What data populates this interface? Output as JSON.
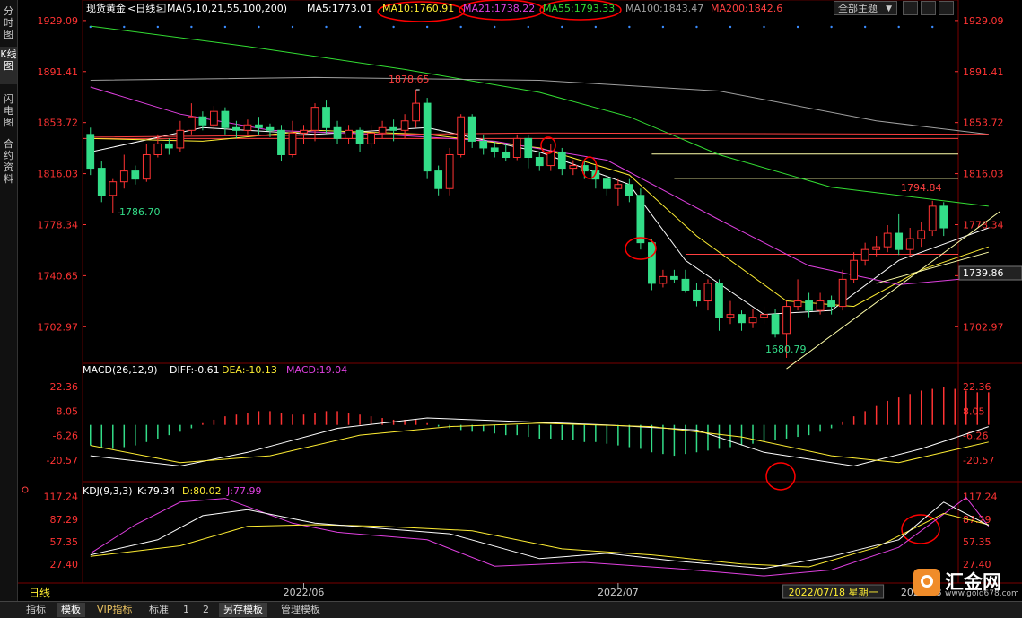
{
  "left_tabs": [
    {
      "label": "分时图",
      "active": false
    },
    {
      "label": "K线图",
      "active": true
    },
    {
      "label": "闪电图",
      "active": false
    },
    {
      "label": "合约资料",
      "active": false
    }
  ],
  "header": {
    "instrument": "现货黄金",
    "period": "<日线>",
    "ma_label": "MA(5,10,21,55,100,200)",
    "ma": [
      {
        "name": "MA5",
        "text": "MA5:1773.01",
        "color": "#ffffff"
      },
      {
        "name": "MA10",
        "text": "MA10:1760.91",
        "color": "#ffee33"
      },
      {
        "name": "MA21",
        "text": "MA21:1738.22",
        "color": "#e040e0"
      },
      {
        "name": "MA55",
        "text": "MA55:1793.33",
        "color": "#33dd33"
      },
      {
        "name": "MA100",
        "text": "MA100:1843.47",
        "color": "#a0a0a0"
      },
      {
        "name": "MA200",
        "text": "MA200:1842.6",
        "color": "#ff4040"
      }
    ],
    "theme_select": "全部主题"
  },
  "price_axis": {
    "ticks": [
      1929.09,
      1891.41,
      1853.72,
      1816.03,
      1778.34,
      1740.65,
      1702.97
    ],
    "current_price": "1739.86",
    "y_range": [
      1680.79,
      1929.09
    ]
  },
  "annotations": {
    "high_1": "1878.65",
    "low_1": "1786.70",
    "low_2": "1680.79",
    "high_2": "1794.84"
  },
  "candles": [
    [
      1845,
      1820,
      1850,
      1815
    ],
    [
      1820,
      1800,
      1825,
      1795
    ],
    [
      1800,
      1810,
      1812,
      1787
    ],
    [
      1810,
      1818,
      1830,
      1805
    ],
    [
      1818,
      1812,
      1822,
      1808
    ],
    [
      1812,
      1830,
      1838,
      1810
    ],
    [
      1830,
      1838,
      1845,
      1828
    ],
    [
      1838,
      1835,
      1842,
      1830
    ],
    [
      1835,
      1848,
      1855,
      1832
    ],
    [
      1848,
      1858,
      1868,
      1845
    ],
    [
      1858,
      1852,
      1862,
      1848
    ],
    [
      1852,
      1862,
      1866,
      1848
    ],
    [
      1862,
      1850,
      1865,
      1845
    ],
    [
      1850,
      1848,
      1855,
      1842
    ],
    [
      1848,
      1852,
      1856,
      1845
    ],
    [
      1852,
      1850,
      1858,
      1845
    ],
    [
      1850,
      1848,
      1853,
      1843
    ],
    [
      1848,
      1830,
      1852,
      1825
    ],
    [
      1830,
      1846,
      1855,
      1828
    ],
    [
      1846,
      1848,
      1852,
      1838
    ],
    [
      1848,
      1865,
      1868,
      1840
    ],
    [
      1865,
      1850,
      1870,
      1846
    ],
    [
      1850,
      1842,
      1855,
      1838
    ],
    [
      1842,
      1848,
      1852,
      1838
    ],
    [
      1848,
      1838,
      1850,
      1832
    ],
    [
      1838,
      1846,
      1852,
      1835
    ],
    [
      1846,
      1850,
      1855,
      1842
    ],
    [
      1850,
      1848,
      1856,
      1840
    ],
    [
      1848,
      1855,
      1860,
      1842
    ],
    [
      1855,
      1868,
      1878,
      1850
    ],
    [
      1868,
      1818,
      1872,
      1812
    ],
    [
      1818,
      1805,
      1822,
      1800
    ],
    [
      1805,
      1830,
      1835,
      1800
    ],
    [
      1830,
      1858,
      1860,
      1828
    ],
    [
      1858,
      1840,
      1860,
      1835
    ],
    [
      1840,
      1835,
      1845,
      1830
    ],
    [
      1835,
      1832,
      1840,
      1828
    ],
    [
      1832,
      1828,
      1838,
      1825
    ],
    [
      1828,
      1842,
      1845,
      1826
    ],
    [
      1842,
      1828,
      1845,
      1820
    ],
    [
      1828,
      1822,
      1832,
      1818
    ],
    [
      1822,
      1832,
      1838,
      1818
    ],
    [
      1832,
      1820,
      1835,
      1815
    ],
    [
      1820,
      1822,
      1826,
      1815
    ],
    [
      1822,
      1818,
      1826,
      1812
    ],
    [
      1818,
      1812,
      1822,
      1805
    ],
    [
      1812,
      1805,
      1815,
      1800
    ],
    [
      1805,
      1808,
      1812,
      1792
    ],
    [
      1808,
      1800,
      1812,
      1795
    ],
    [
      1800,
      1765,
      1805,
      1760
    ],
    [
      1765,
      1735,
      1768,
      1730
    ],
    [
      1735,
      1740,
      1745,
      1732
    ],
    [
      1740,
      1738,
      1745,
      1735
    ],
    [
      1738,
      1730,
      1745,
      1728
    ],
    [
      1730,
      1722,
      1735,
      1718
    ],
    [
      1722,
      1735,
      1738,
      1715
    ],
    [
      1735,
      1710,
      1738,
      1700
    ],
    [
      1710,
      1712,
      1722,
      1705
    ],
    [
      1712,
      1706,
      1715,
      1700
    ],
    [
      1706,
      1710,
      1716,
      1702
    ],
    [
      1710,
      1712,
      1718,
      1705
    ],
    [
      1712,
      1698,
      1716,
      1695
    ],
    [
      1698,
      1718,
      1722,
      1680
    ],
    [
      1718,
      1722,
      1738,
      1715
    ],
    [
      1722,
      1715,
      1728,
      1710
    ],
    [
      1715,
      1722,
      1728,
      1712
    ],
    [
      1722,
      1718,
      1726,
      1712
    ],
    [
      1718,
      1738,
      1745,
      1715
    ],
    [
      1738,
      1752,
      1758,
      1735
    ],
    [
      1752,
      1760,
      1765,
      1748
    ],
    [
      1760,
      1762,
      1770,
      1755
    ],
    [
      1762,
      1772,
      1778,
      1758
    ],
    [
      1772,
      1760,
      1786,
      1756
    ],
    [
      1760,
      1768,
      1776,
      1755
    ],
    [
      1768,
      1774,
      1780,
      1762
    ],
    [
      1774,
      1792,
      1796,
      1770
    ],
    [
      1792,
      1776,
      1795,
      1770
    ]
  ],
  "ma_lines": {
    "ma5": [
      [
        0,
        1832
      ],
      [
        10,
        1850
      ],
      [
        20,
        1845
      ],
      [
        30,
        1850
      ],
      [
        40,
        1832
      ],
      [
        48,
        1808
      ],
      [
        53,
        1752
      ],
      [
        60,
        1712
      ],
      [
        66,
        1715
      ],
      [
        72,
        1752
      ],
      [
        80,
        1776
      ]
    ],
    "ma10": [
      [
        0,
        1842
      ],
      [
        10,
        1840
      ],
      [
        20,
        1848
      ],
      [
        30,
        1845
      ],
      [
        40,
        1835
      ],
      [
        48,
        1815
      ],
      [
        54,
        1770
      ],
      [
        62,
        1722
      ],
      [
        68,
        1718
      ],
      [
        74,
        1745
      ],
      [
        80,
        1762
      ]
    ],
    "ma21": [
      [
        0,
        1880
      ],
      [
        8,
        1860
      ],
      [
        16,
        1848
      ],
      [
        26,
        1845
      ],
      [
        36,
        1840
      ],
      [
        46,
        1826
      ],
      [
        56,
        1782
      ],
      [
        64,
        1748
      ],
      [
        72,
        1734
      ],
      [
        80,
        1740
      ]
    ],
    "ma55": [
      [
        0,
        1925
      ],
      [
        14,
        1910
      ],
      [
        28,
        1893
      ],
      [
        40,
        1876
      ],
      [
        48,
        1858
      ],
      [
        56,
        1830
      ],
      [
        66,
        1806
      ],
      [
        74,
        1798
      ],
      [
        80,
        1792
      ]
    ],
    "ma100": [
      [
        0,
        1885
      ],
      [
        20,
        1887
      ],
      [
        40,
        1885
      ],
      [
        56,
        1877
      ],
      [
        70,
        1855
      ],
      [
        80,
        1845
      ]
    ],
    "ma200": [
      [
        0,
        1843
      ],
      [
        40,
        1846
      ],
      [
        80,
        1845
      ]
    ]
  },
  "trend_lines": {
    "horizontals": [
      {
        "y": 1830.5,
        "x0": 50,
        "x1": 81,
        "color": "#ffffaa"
      },
      {
        "y": 1812.5,
        "x0": 52,
        "x1": 81,
        "color": "#ffffaa"
      },
      {
        "y": 1756.5,
        "x0": 53,
        "x1": 81,
        "color": "#ff4040"
      }
    ],
    "diagonals": [
      {
        "from": [
          62,
          1672
        ],
        "to": [
          81,
          1788
        ],
        "color": "#ffffaa"
      },
      {
        "from": [
          70,
          1735
        ],
        "to": [
          80,
          1758
        ],
        "color": "#ffffaa"
      }
    ]
  },
  "macd": {
    "label": "MACD(26,12,9)",
    "diff": "DIFF:-0.61",
    "dea": "DEA:-10.13",
    "macd": "MACD:19.04",
    "ticks": [
      22.36,
      8.05,
      -6.26,
      -20.57
    ],
    "range": [
      -30,
      22.36
    ],
    "hist": [
      -12,
      -13,
      -14,
      -13,
      -12,
      -10,
      -8,
      -6,
      -4,
      -2,
      1,
      3,
      5,
      6,
      7,
      8,
      8,
      7,
      6,
      6,
      7,
      8,
      8,
      7,
      6,
      5,
      4,
      3,
      3,
      3,
      1,
      -1,
      -2,
      -3,
      -4,
      -4,
      -5,
      -6,
      -6,
      -7,
      -8,
      -8,
      -9,
      -9,
      -10,
      -10,
      -11,
      -12,
      -13,
      -14,
      -16,
      -17,
      -18,
      -17,
      -16,
      -15,
      -14,
      -13,
      -12,
      -11,
      -10,
      -9,
      -8,
      -7,
      -6,
      -4,
      -2,
      2,
      5,
      8,
      11,
      14,
      16,
      18,
      20,
      21,
      22,
      21,
      20,
      19,
      19
    ],
    "diff_line": [
      [
        0,
        -18
      ],
      [
        8,
        -24
      ],
      [
        14,
        -16
      ],
      [
        22,
        -2
      ],
      [
        30,
        4
      ],
      [
        38,
        2
      ],
      [
        46,
        0
      ],
      [
        54,
        -3
      ],
      [
        60,
        -16
      ],
      [
        68,
        -24
      ],
      [
        74,
        -14
      ],
      [
        80,
        -1
      ]
    ],
    "dea_line": [
      [
        0,
        -12
      ],
      [
        8,
        -22
      ],
      [
        16,
        -18
      ],
      [
        24,
        -6
      ],
      [
        32,
        -1
      ],
      [
        40,
        1
      ],
      [
        50,
        -1
      ],
      [
        58,
        -7
      ],
      [
        66,
        -18
      ],
      [
        72,
        -22
      ],
      [
        78,
        -13
      ],
      [
        80,
        -10
      ]
    ]
  },
  "kdj": {
    "label": "KDJ(9,3,3)",
    "k": "K:79.34",
    "d": "D:80.02",
    "j": "J:77.99",
    "ticks": [
      117.24,
      87.29,
      57.35,
      27.4
    ],
    "range": [
      10,
      117.24
    ],
    "k_line": [
      [
        0,
        40
      ],
      [
        6,
        60
      ],
      [
        10,
        92
      ],
      [
        14,
        100
      ],
      [
        20,
        82
      ],
      [
        26,
        75
      ],
      [
        32,
        68
      ],
      [
        40,
        35
      ],
      [
        46,
        42
      ],
      [
        52,
        32
      ],
      [
        60,
        22
      ],
      [
        66,
        38
      ],
      [
        72,
        60
      ],
      [
        76,
        110
      ],
      [
        80,
        79
      ]
    ],
    "d_line": [
      [
        0,
        38
      ],
      [
        8,
        52
      ],
      [
        14,
        78
      ],
      [
        20,
        80
      ],
      [
        26,
        78
      ],
      [
        34,
        72
      ],
      [
        42,
        48
      ],
      [
        50,
        40
      ],
      [
        58,
        28
      ],
      [
        64,
        24
      ],
      [
        70,
        50
      ],
      [
        76,
        95
      ],
      [
        80,
        80
      ]
    ],
    "j_line": [
      [
        0,
        42
      ],
      [
        4,
        80
      ],
      [
        8,
        110
      ],
      [
        12,
        115
      ],
      [
        18,
        82
      ],
      [
        22,
        70
      ],
      [
        30,
        60
      ],
      [
        36,
        25
      ],
      [
        44,
        30
      ],
      [
        52,
        22
      ],
      [
        60,
        12
      ],
      [
        66,
        20
      ],
      [
        72,
        50
      ],
      [
        78,
        116
      ],
      [
        80,
        78
      ]
    ]
  },
  "x_axis": {
    "labels": [
      {
        "text": "2022/06",
        "at": 19
      },
      {
        "text": "2022/07",
        "at": 47
      },
      {
        "text": "2022/08",
        "at": 74
      }
    ],
    "cursor_date": "2022/07/18 星期一",
    "cursor_at": 66,
    "period_label": "日线"
  },
  "bottom_tabs": [
    {
      "label": "指标",
      "active": false
    },
    {
      "label": "模板",
      "active": true
    },
    {
      "label": "VIP指标",
      "active": false,
      "vip": true
    },
    {
      "label": "标准",
      "active": false
    },
    {
      "label": "1",
      "active": false
    },
    {
      "label": "2",
      "active": false
    },
    {
      "label": "另存模板",
      "active": false
    },
    {
      "label": "管理模板",
      "active": false
    }
  ],
  "watermark": {
    "text": "汇金网",
    "url": "www.gold678.com"
  },
  "colors": {
    "up": "#ff3333",
    "down": "#33dd88",
    "axis_text": "#ff3333",
    "grid": "#5a0000",
    "circle": "#ff0000"
  }
}
